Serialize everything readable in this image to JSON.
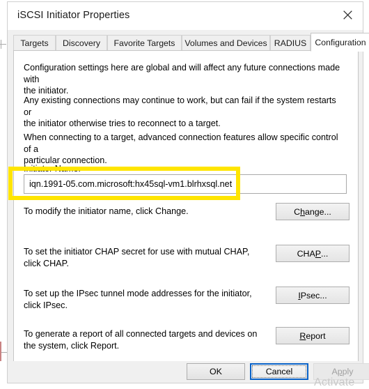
{
  "window": {
    "title": "iSCSI Initiator Properties",
    "close_icon": "close-icon"
  },
  "tabs": [
    {
      "label": "Targets",
      "selected": false
    },
    {
      "label": "Discovery",
      "selected": false
    },
    {
      "label": "Favorite Targets",
      "selected": false
    },
    {
      "label": "Volumes and Devices",
      "selected": false
    },
    {
      "label": "RADIUS",
      "selected": false
    },
    {
      "label": "Configuration",
      "selected": true
    }
  ],
  "panel": {
    "paragraph1": "Configuration settings here are global and will affect any future connections made with\nthe initiator.",
    "paragraph2": "Any existing connections may continue to work, but can fail if the system restarts or\nthe initiator otherwise tries to reconnect to a target.",
    "paragraph3": "When connecting to a target, advanced connection features allow specific control of a\nparticular connection.",
    "initiator_name_label": "Initiator Name:",
    "initiator_name_value": "iqn.1991-05.com.microsoft:hx45sql-vm1.blrhxsql.net",
    "initiator_name_placeholder": "",
    "rows": [
      {
        "description": "To modify the initiator name, click Change.",
        "button_before": "C",
        "button_accel": "h",
        "button_after": "ange...",
        "button_name": "change-button"
      },
      {
        "description": "To set the initiator CHAP secret for use with mutual CHAP,\nclick CHAP.",
        "button_before": "CHA",
        "button_accel": "P",
        "button_after": "...",
        "button_name": "chap-button"
      },
      {
        "description": "To set up the IPsec tunnel mode addresses for the initiator,\nclick IPsec.",
        "button_before": "",
        "button_accel": "I",
        "button_after": "Psec...",
        "button_name": "ipsec-button"
      },
      {
        "description": "To generate a report of all connected targets and devices on\nthe system, click Report.",
        "button_before": "",
        "button_accel": "R",
        "button_after": "eport",
        "button_name": "report-button"
      }
    ]
  },
  "footer": {
    "ok_label": "OK",
    "cancel_label": "Cancel",
    "apply_before": "A",
    "apply_accel": "p",
    "apply_after": "ply"
  },
  "annotation": {
    "highlight_color": "#ffe500"
  },
  "watermark": {
    "text": "Activate"
  }
}
